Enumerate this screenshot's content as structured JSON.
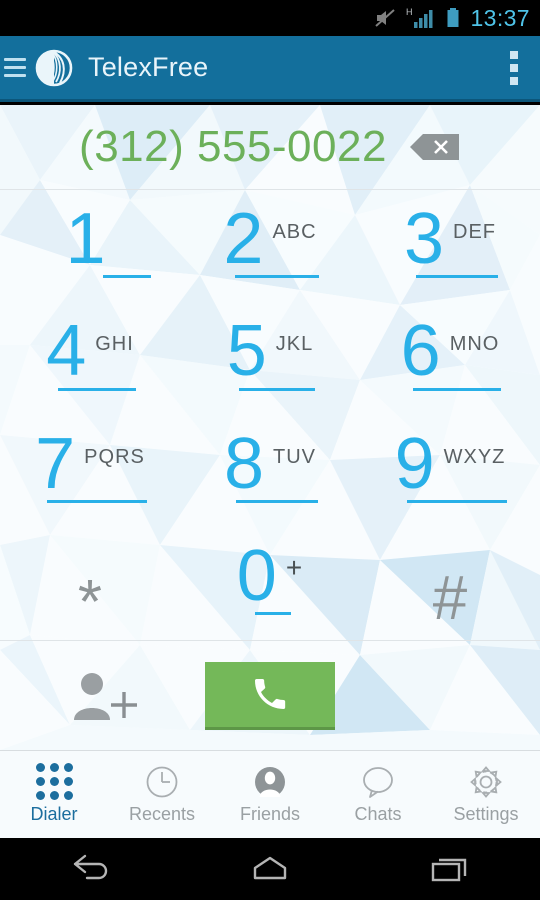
{
  "status_bar": {
    "time": "13:37",
    "icons": [
      "mute-icon",
      "signal-h-icon",
      "battery-icon"
    ],
    "network_label": "H",
    "clock_color": "#4FC3E8"
  },
  "action_bar": {
    "menu_icon": "hamburger-icon",
    "logo_icon": "telexfree-logo-icon",
    "title": "TelexFree",
    "overflow_icon": "overflow-menu-icon",
    "background_color": "#136F9C"
  },
  "dialer": {
    "number": "(312) 555-0022",
    "number_color": "#6CB05A",
    "backspace_icon": "backspace-icon",
    "keys": [
      {
        "digit": "1",
        "letters": "",
        "underline": true,
        "symbol": false
      },
      {
        "digit": "2",
        "letters": "ABC",
        "underline": true,
        "symbol": false
      },
      {
        "digit": "3",
        "letters": "DEF",
        "underline": true,
        "symbol": false
      },
      {
        "digit": "4",
        "letters": "GHI",
        "underline": true,
        "symbol": false
      },
      {
        "digit": "5",
        "letters": "JKL",
        "underline": true,
        "symbol": false
      },
      {
        "digit": "6",
        "letters": "MNO",
        "underline": true,
        "symbol": false
      },
      {
        "digit": "7",
        "letters": "PQRS",
        "underline": true,
        "symbol": false
      },
      {
        "digit": "8",
        "letters": "TUV",
        "underline": true,
        "symbol": false
      },
      {
        "digit": "9",
        "letters": "WXYZ",
        "underline": true,
        "symbol": false
      },
      {
        "digit": "*",
        "letters": "",
        "underline": false,
        "symbol": true
      },
      {
        "digit": "0",
        "letters": "+",
        "underline": true,
        "symbol": false
      },
      {
        "digit": "#",
        "letters": "",
        "underline": false,
        "symbol": true
      }
    ],
    "key_color": "#29B0E8",
    "symbol_color": "#8E9496",
    "add_contact_icon": "add-contact-icon",
    "call_icon": "phone-handset-icon",
    "call_button_color": "#74B859"
  },
  "tabs": [
    {
      "label": "Dialer",
      "icon": "keypad-dots-icon",
      "active": true
    },
    {
      "label": "Recents",
      "icon": "clock-icon",
      "active": false
    },
    {
      "label": "Friends",
      "icon": "person-icon",
      "active": false
    },
    {
      "label": "Chats",
      "icon": "chat-bubble-icon",
      "active": false
    },
    {
      "label": "Settings",
      "icon": "gear-icon",
      "active": false
    }
  ],
  "nav_bar": {
    "back_icon": "back-arrow-icon",
    "home_icon": "home-icon",
    "recents_icon": "recent-apps-icon"
  }
}
